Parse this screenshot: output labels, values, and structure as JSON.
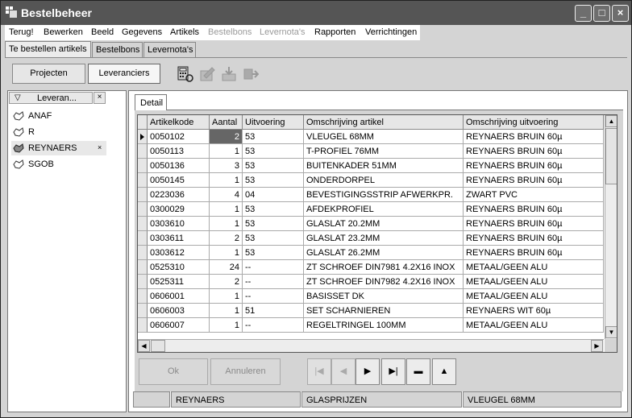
{
  "window": {
    "title": "Bestelbeheer"
  },
  "menu": [
    {
      "label": "Terug!",
      "disabled": false
    },
    {
      "label": "Bewerken",
      "disabled": false
    },
    {
      "label": "Beeld",
      "disabled": false
    },
    {
      "label": "Gegevens",
      "disabled": false
    },
    {
      "label": "Artikels",
      "disabled": false
    },
    {
      "label": "Bestelbons",
      "disabled": true
    },
    {
      "label": "Levernota's",
      "disabled": true
    },
    {
      "label": "Rapporten",
      "disabled": false
    },
    {
      "label": "Verrichtingen",
      "disabled": false
    }
  ],
  "tabs": [
    {
      "label": "Te bestellen artikels",
      "active": true
    },
    {
      "label": "Bestelbons",
      "active": false
    },
    {
      "label": "Levernota's",
      "active": false
    }
  ],
  "toolbar": {
    "projecten": "Projecten",
    "leveranciers": "Leveranciers"
  },
  "left": {
    "header": "Leveran...",
    "close": "×",
    "filter_icon": "▽",
    "items": [
      {
        "name": "ANAF",
        "selected": false
      },
      {
        "name": "R",
        "selected": false
      },
      {
        "name": "REYNAERS",
        "selected": true
      },
      {
        "name": "SGOB",
        "selected": false
      }
    ],
    "item_close": "×"
  },
  "detail_tab": "Detail",
  "grid": {
    "columns": [
      "Artikelkode",
      "Aantal",
      "Uitvoering",
      "Omschrijving artikel",
      "Omschrijving uitvoering"
    ],
    "rows": [
      [
        "0050102",
        "2",
        "53",
        "VLEUGEL 68MM",
        "REYNAERS BRUIN 60µ"
      ],
      [
        "0050113",
        "1",
        "53",
        "T-PROFIEL 76MM",
        "REYNAERS BRUIN 60µ"
      ],
      [
        "0050136",
        "3",
        "53",
        "BUITENKADER 51MM",
        "REYNAERS BRUIN 60µ"
      ],
      [
        "0050145",
        "1",
        "53",
        "ONDERDORPEL",
        "REYNAERS BRUIN 60µ"
      ],
      [
        "0223036",
        "4",
        "04",
        "BEVESTIGINGSSTRIP AFWERKPR.",
        "ZWART PVC"
      ],
      [
        "0300029",
        "1",
        "53",
        "AFDEKPROFIEL",
        "REYNAERS BRUIN 60µ"
      ],
      [
        "0303610",
        "1",
        "53",
        "GLASLAT 20.2MM",
        "REYNAERS BRUIN 60µ"
      ],
      [
        "0303611",
        "2",
        "53",
        "GLASLAT 23.2MM",
        "REYNAERS BRUIN 60µ"
      ],
      [
        "0303612",
        "1",
        "53",
        "GLASLAT 26.2MM",
        "REYNAERS BRUIN 60µ"
      ],
      [
        "0525310",
        "24",
        "--",
        "ZT SCHROEF DIN7981 4.2X16 INOX",
        "METAAL/GEEN ALU"
      ],
      [
        "0525311",
        "2",
        "--",
        "ZT SCHROEF DIN7982 4.2X16 INOX",
        "METAAL/GEEN ALU"
      ],
      [
        "0606001",
        "1",
        "--",
        "BASISSET DK",
        "METAAL/GEEN ALU"
      ],
      [
        "0606003",
        "1",
        "51",
        "SET SCHARNIEREN",
        "REYNAERS WIT 60µ"
      ],
      [
        "0606007",
        "1",
        "--",
        "REGELTRINGEL 100MM",
        "METAAL/GEEN ALU"
      ]
    ]
  },
  "buttons": {
    "ok": "Ok",
    "annuleren": "Annuleren",
    "nav": [
      "|◀",
      "◀",
      "▶",
      "▶|",
      "▬",
      "▲"
    ]
  },
  "status": [
    "",
    "REYNAERS",
    "GLASPRIJZEN",
    "VLEUGEL 68MM"
  ]
}
